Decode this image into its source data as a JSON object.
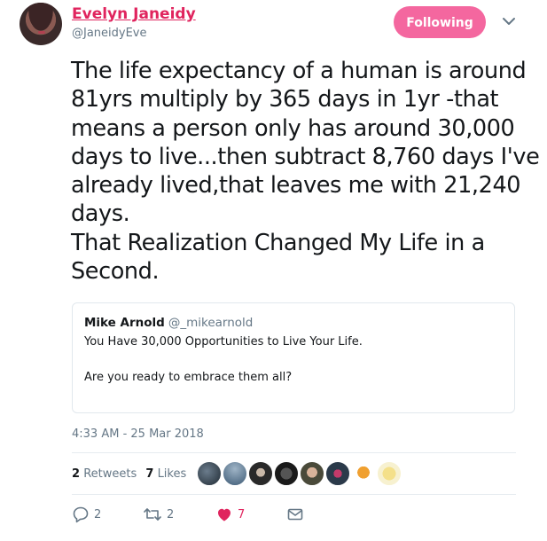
{
  "author": {
    "display_name": "Evelyn Janeidy",
    "handle": "@JaneidyEve"
  },
  "follow_button": {
    "label": "Following",
    "color": "#f4679f"
  },
  "tweet": {
    "lines": [
      "The life expectancy of a human is around",
      "81yrs multiply by 365 days in 1yr -that",
      "means a person only has around 30,000",
      "days to live...then subtract 8,760 days I've",
      "already lived,that leaves me with 21,240",
      "days.",
      "That Realization Changed My Life in a",
      "Second."
    ]
  },
  "quoted_tweet": {
    "name": "Mike Arnold",
    "handle": "@_mikearnold",
    "line1": "You Have 30,000 Opportunities to Live Your Life.",
    "line2": "Are you ready to embrace them all?"
  },
  "timestamp": "4:33 AM - 25 Mar 2018",
  "stats": {
    "retweets_count": "2",
    "retweets_label": "Retweets",
    "likes_count": "7",
    "likes_label": "Likes"
  },
  "liker_avatars": 8,
  "actions": {
    "reply_count": "2",
    "retweet_count": "2",
    "like_count": "7"
  },
  "colors": {
    "accent_pink": "#e0245e",
    "muted": "#657786",
    "like_red": "#e0245e"
  }
}
